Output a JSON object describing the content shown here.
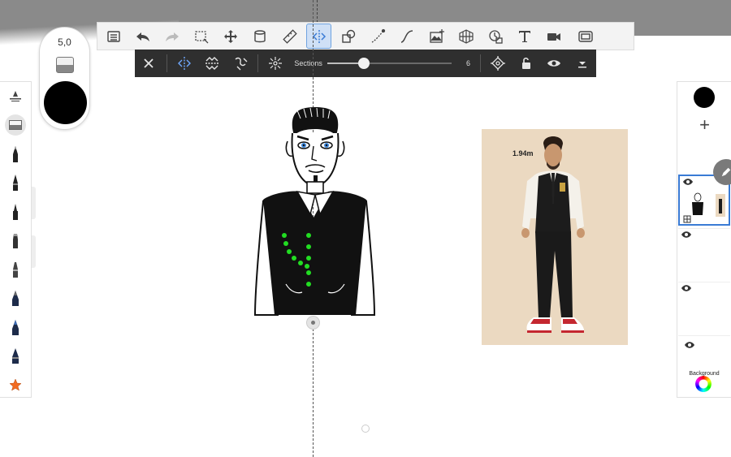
{
  "toolbar": {
    "tools": [
      {
        "name": "gallery-icon",
        "active": false
      },
      {
        "name": "undo-icon",
        "active": false
      },
      {
        "name": "redo-icon",
        "active": false
      },
      {
        "name": "selection-icon",
        "active": false
      },
      {
        "name": "transform-icon",
        "active": false
      },
      {
        "name": "fill-icon",
        "active": false
      },
      {
        "name": "ruler-icon",
        "active": false
      },
      {
        "name": "symmetry-icon",
        "active": true
      },
      {
        "name": "shapes-icon",
        "active": false
      },
      {
        "name": "stroke-icon",
        "active": false
      },
      {
        "name": "curve-icon",
        "active": false
      },
      {
        "name": "import-image-icon",
        "active": false
      },
      {
        "name": "perspective-icon",
        "active": false
      },
      {
        "name": "timelapse-icon",
        "active": false
      },
      {
        "name": "text-icon",
        "active": false
      },
      {
        "name": "record-icon",
        "active": false
      },
      {
        "name": "fullscreen-icon",
        "active": false
      }
    ]
  },
  "symmetry": {
    "sections_label": "Sections",
    "sections_value": "6",
    "slider_fraction": 0.28
  },
  "brush": {
    "size": "5,0",
    "color": "#000000"
  },
  "layers": {
    "current_color": "#000000",
    "background_label": "Background"
  },
  "reference": {
    "label": "1.94m"
  },
  "colors": {
    "accent": "#3a7bd5",
    "symmetry_bar": "#2f2f2f",
    "dots": "#22dd22"
  }
}
